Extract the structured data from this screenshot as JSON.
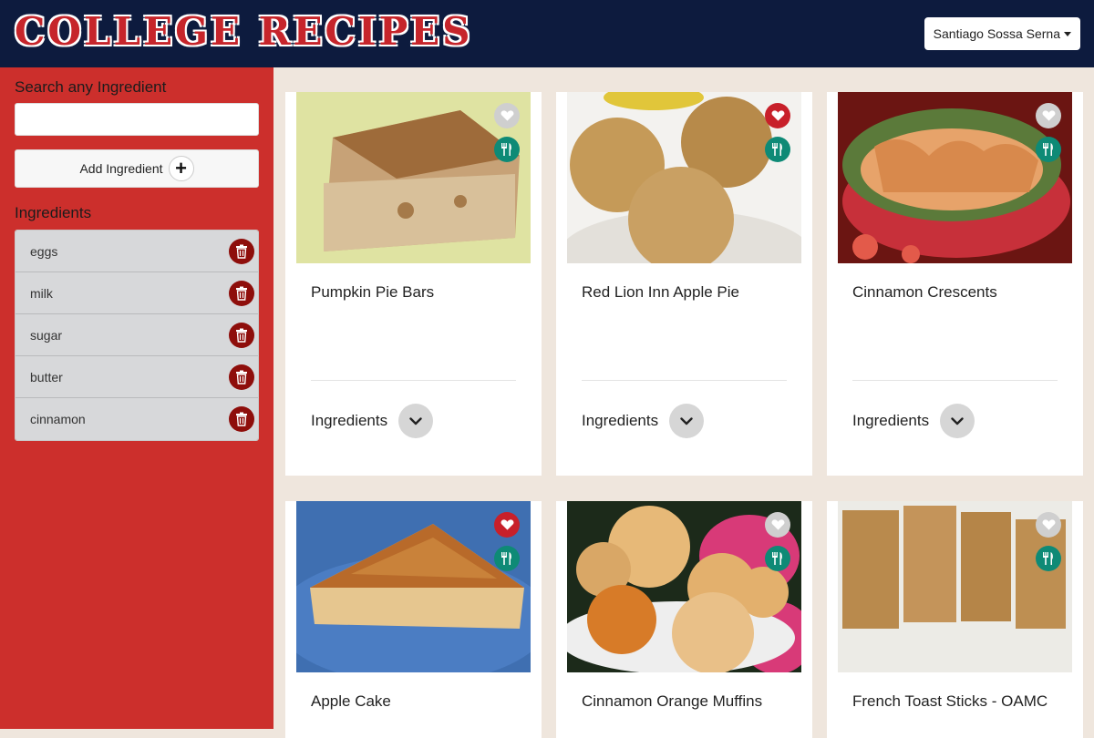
{
  "app": {
    "title": "COLLEGE RECIPES"
  },
  "header": {
    "user_name": "Santiago Sossa Serna"
  },
  "sidebar": {
    "search_label": "Search any Ingredient",
    "search_value": "",
    "add_label": "Add Ingredient",
    "ingredients_title": "Ingredients",
    "ingredients": [
      "eggs",
      "milk",
      "sugar",
      "butter",
      "cinnamon"
    ]
  },
  "recipes": [
    {
      "title": "Pumpkin Pie Bars",
      "favorite": false,
      "ingredients_label": "Ingredients"
    },
    {
      "title": "Red Lion Inn Apple Pie",
      "favorite": true,
      "ingredients_label": "Ingredients"
    },
    {
      "title": "Cinnamon Crescents",
      "favorite": false,
      "ingredients_label": "Ingredients"
    },
    {
      "title": "Apple Cake",
      "favorite": true
    },
    {
      "title": "Cinnamon Orange Muffins",
      "favorite": false
    },
    {
      "title": "French Toast Sticks - OAMC",
      "favorite": false
    }
  ],
  "icons": {
    "favorite": "heart-icon",
    "meal": "utensils-icon",
    "expand": "chevron-down-icon",
    "delete": "trash-icon",
    "add": "plus-icon"
  },
  "colors": {
    "header": "#0d1b3e",
    "sidebar": "#cc2f2c",
    "background": "#efe6dd",
    "favorite_on": "#c8202a",
    "meal_badge": "#0e8a76",
    "delete": "#8e0e0b"
  }
}
